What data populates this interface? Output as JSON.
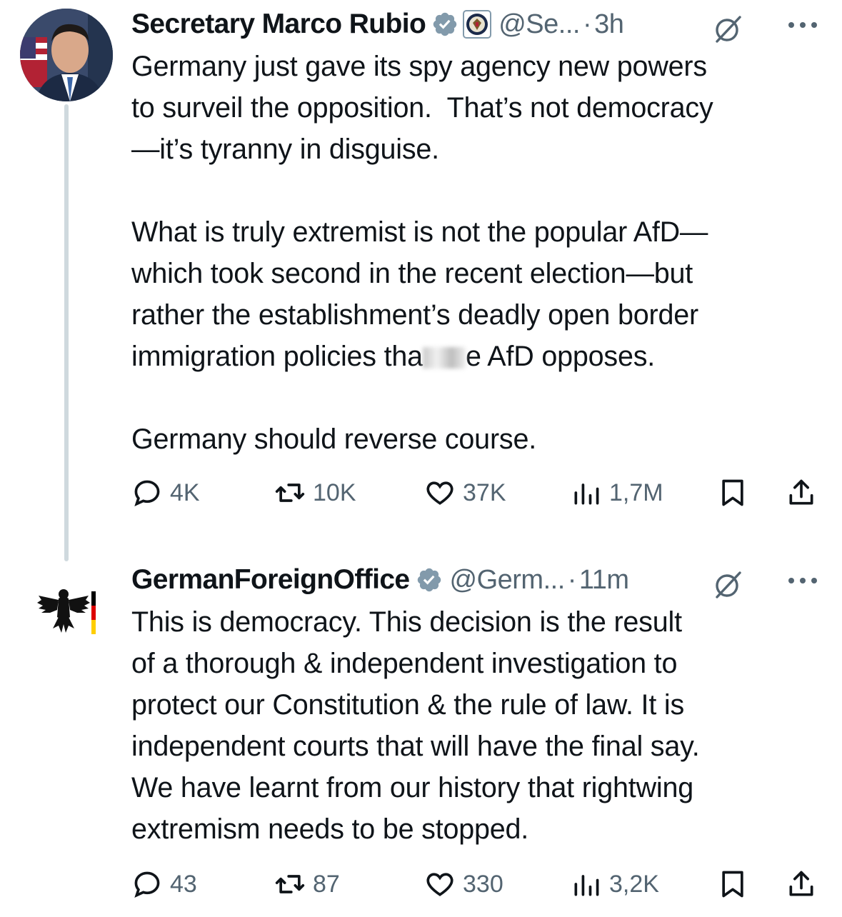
{
  "tweet1": {
    "name": "Secretary Marco Rubio",
    "handle": "@Se...",
    "sep": "·",
    "time": "3h",
    "para1": "Germany just gave its spy agency new powers\nto surveil the opposition.  That’s not democracy\n—it’s tyranny in disguise.",
    "para2a": "What is truly extremist is not the popular AfD—\nwhich took second in the recent election—but\nrather the establishment’s deadly open border\nimmigration policies tha",
    "para2b": "e AfD opposes.",
    "para3": "Germany should reverse course.",
    "replies": "4K",
    "reposts": "10K",
    "likes": "37K",
    "views": "1,7M"
  },
  "tweet2": {
    "name": "GermanForeignOffice",
    "handle": "@Germ...",
    "sep": "·",
    "time": "11m",
    "text": "This is democracy. This decision is the result\nof a thorough & independent investigation to\nprotect our Constitution & the rule of law. It is\nindependent courts that will have the final say.\nWe have learnt from our history that rightwing\nextremism needs to be stopped.",
    "replies": "43",
    "reposts": "87",
    "likes": "330",
    "views": "3,2K"
  },
  "colors": {
    "verified": "#829aab",
    "muted": "#536471",
    "line": "#cfd9de"
  },
  "icons": [
    "verified-badge-icon",
    "state-seal-icon",
    "grok-icon",
    "more-icon",
    "reply-icon",
    "repost-icon",
    "like-icon",
    "views-icon",
    "bookmark-icon",
    "share-icon",
    "eagle-icon"
  ]
}
